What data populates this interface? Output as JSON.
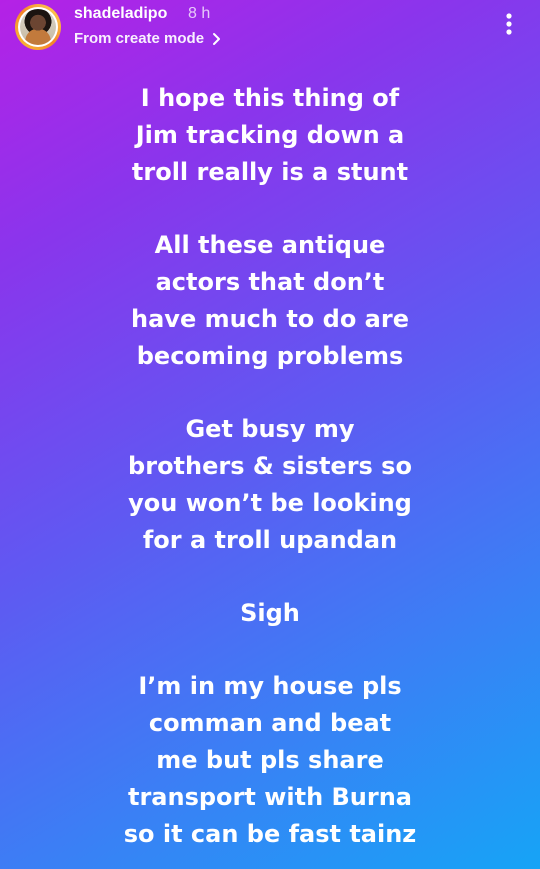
{
  "header": {
    "username": "shadeladipo",
    "timestamp": "8 h",
    "subtitle": "From create mode",
    "subtitle_icon": "chevron-right-icon",
    "menu_icon": "more-vertical-icon"
  },
  "caption": {
    "paragraphs": [
      {
        "lines": [
          "I hope this thing of",
          "Jim tracking down a",
          "troll really is a stunt"
        ]
      },
      {
        "lines": [
          "All these antique",
          "actors that don’t",
          "have much to do are",
          "becoming problems"
        ]
      },
      {
        "lines": [
          "Get busy my",
          "brothers & sisters so",
          "you won’t be looking",
          "for a troll upandan"
        ]
      },
      {
        "lines": [
          "Sigh"
        ]
      },
      {
        "lines": [
          "I’m in my house pls",
          "comman and beat",
          "me but pls share",
          "transport with Burna",
          "so it can be fast tainz"
        ]
      }
    ]
  },
  "colors": {
    "gradient_start": "#b521e6",
    "gradient_mid": "#5f59f2",
    "gradient_end": "#16a4f6",
    "text": "#ffffff"
  }
}
